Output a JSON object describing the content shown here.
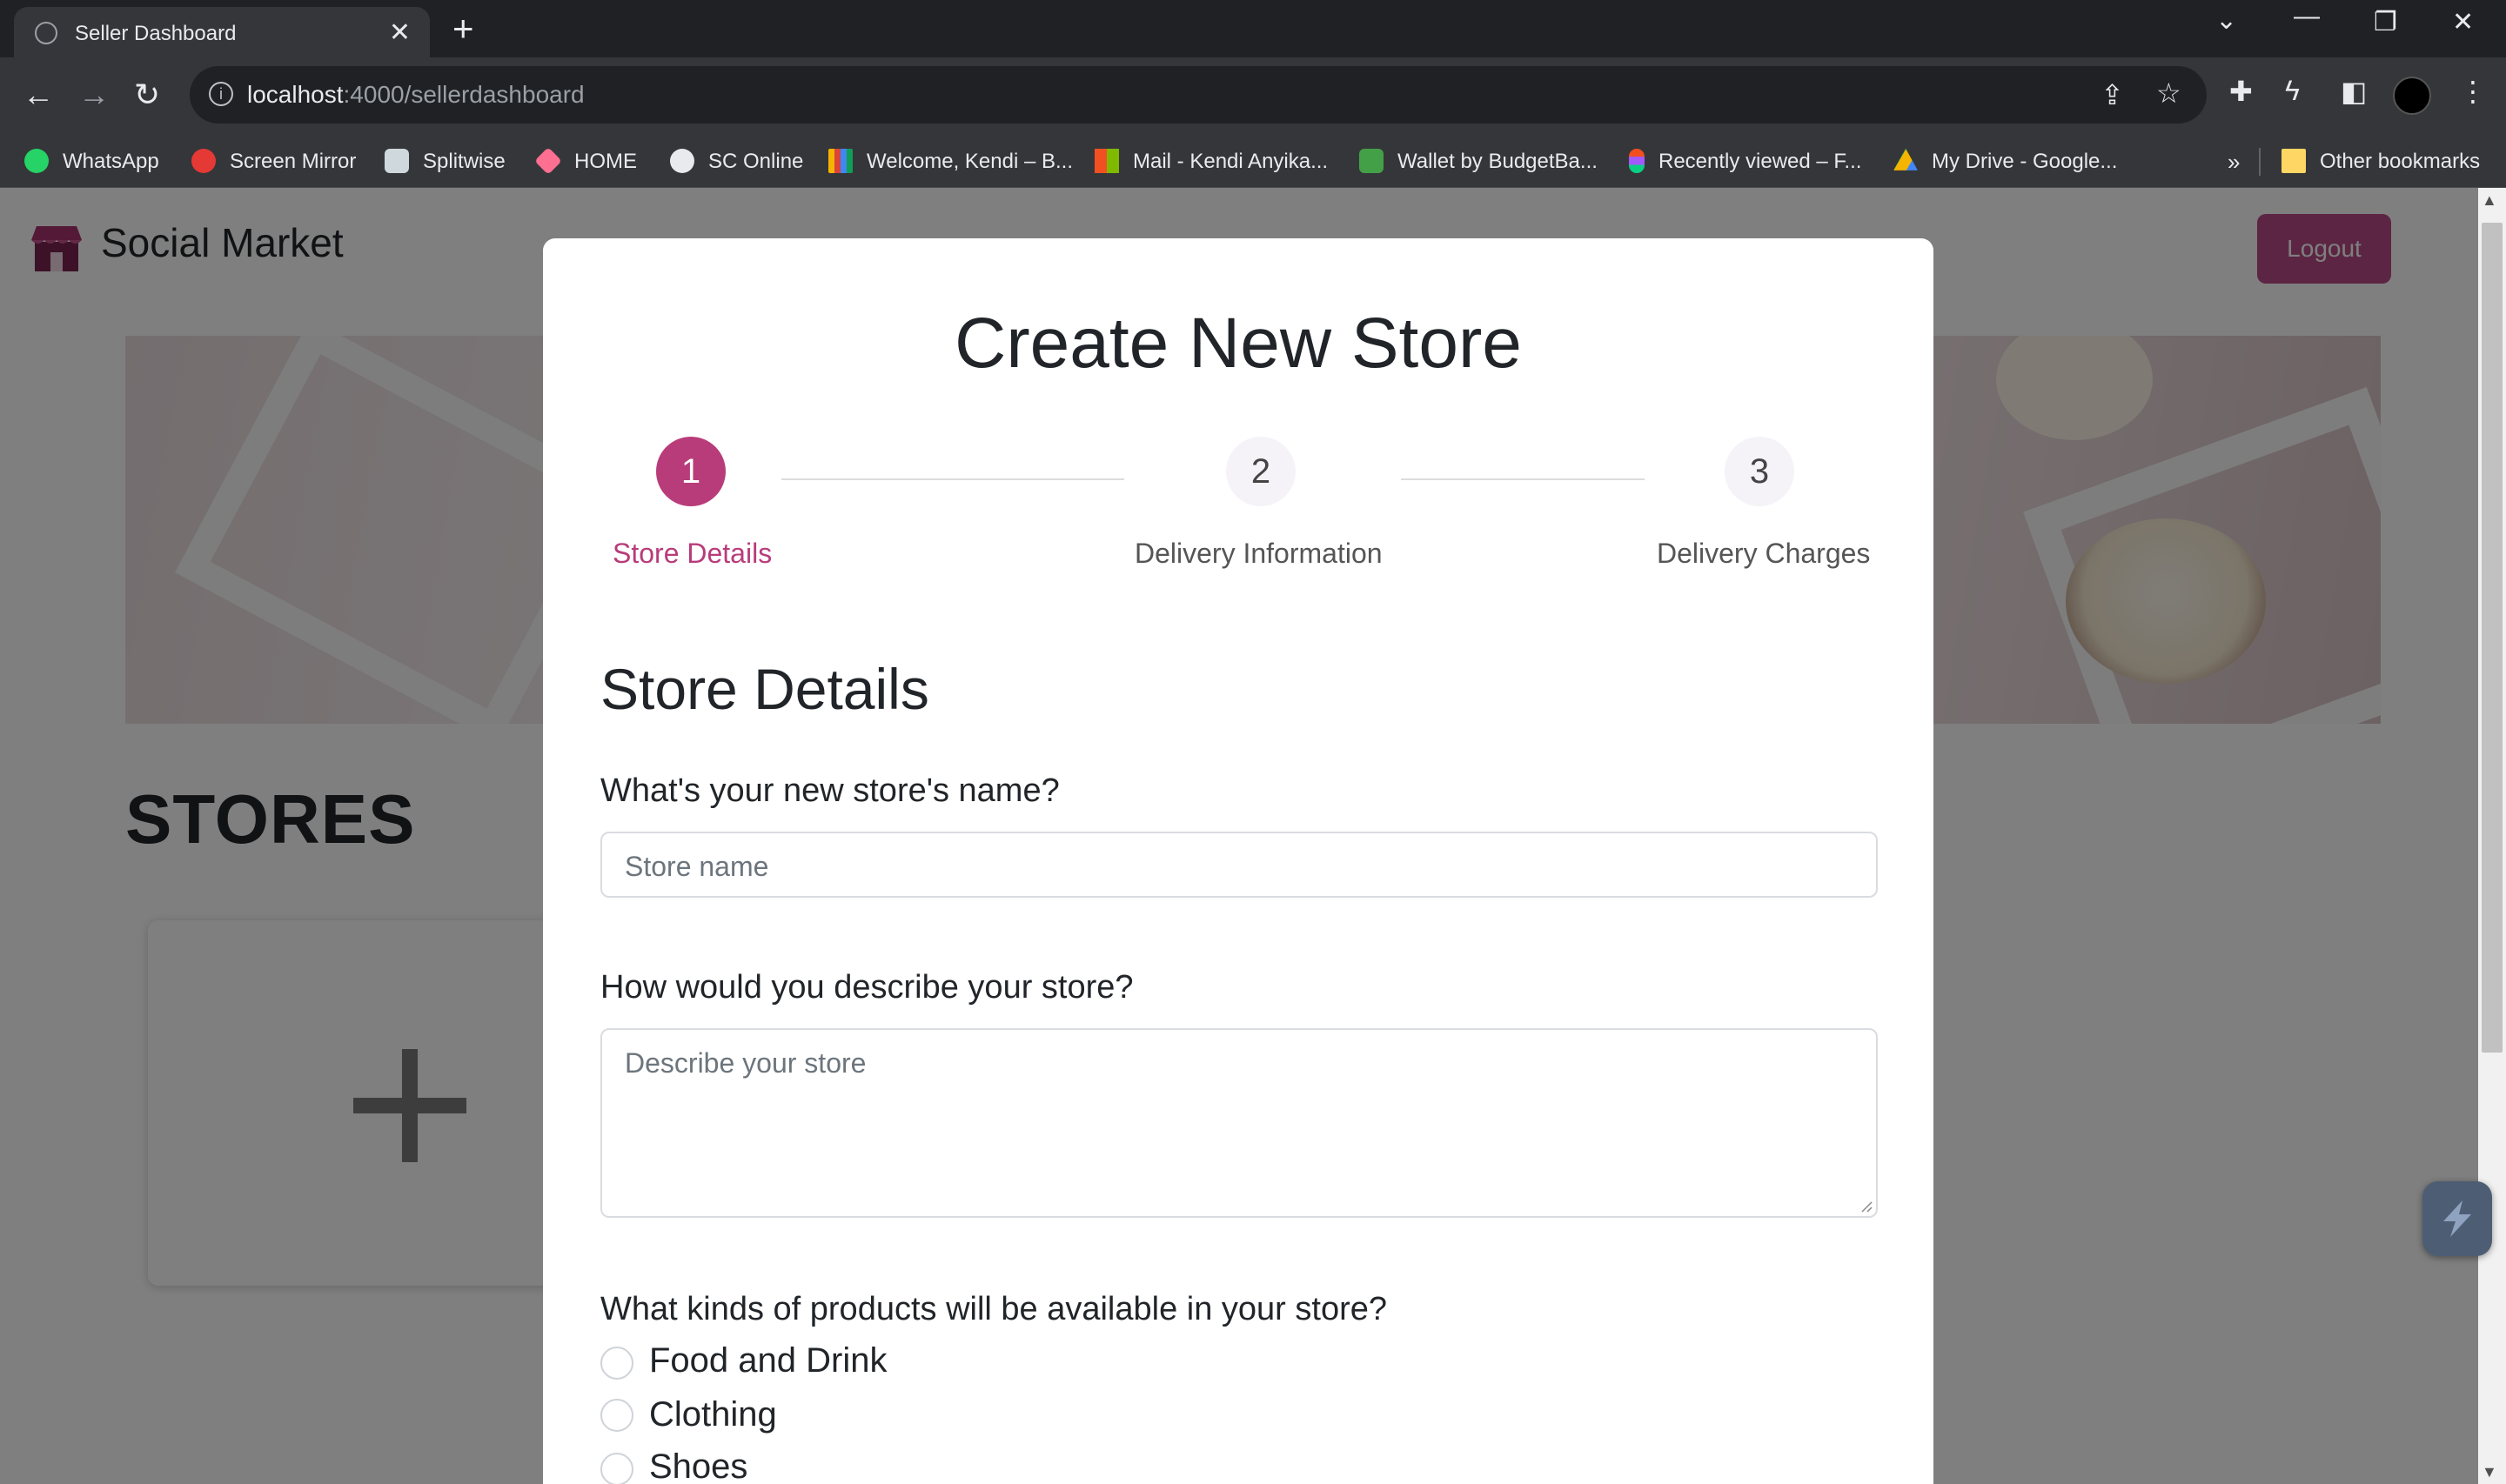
{
  "browser": {
    "tab_title": "Seller Dashboard",
    "url_host": "localhost",
    "url_path": ":4000/sellerdashboard",
    "bookmarks": [
      {
        "label": "WhatsApp",
        "color": "#25d366"
      },
      {
        "label": "Screen Mirror",
        "color": "#e53935"
      },
      {
        "label": "Splitwise",
        "color": "#cfd8dc"
      },
      {
        "label": "HOME",
        "color": "#ff6f91"
      },
      {
        "label": "SC Online",
        "color": "#e8eaed"
      },
      {
        "label": "Welcome, Kendi – B...",
        "color": "#f4b400"
      },
      {
        "label": "Mail - Kendi Anyika...",
        "color": "#f25022"
      },
      {
        "label": "Wallet by BudgetBa...",
        "color": "#43a047"
      },
      {
        "label": "Recently viewed – F...",
        "color": "#a259ff"
      },
      {
        "label": "My Drive - Google...",
        "color": "#0f9d58"
      }
    ],
    "other_bookmarks": "Other bookmarks",
    "overflow": "»"
  },
  "page": {
    "brand": "Social Market",
    "logout_label": "Logout",
    "stores_title": "STORES",
    "add_symbol": "+",
    "accent_color": "#b83c7a"
  },
  "modal": {
    "title": "Create New Store",
    "steps": [
      {
        "number": "1",
        "label": "Store Details",
        "active": true
      },
      {
        "number": "2",
        "label": "Delivery Information",
        "active": false
      },
      {
        "number": "3",
        "label": "Delivery Charges",
        "active": false
      }
    ],
    "section_title": "Store Details",
    "name_question": "What's your new store's name?",
    "name_placeholder": "Store name",
    "describe_question": "How would you describe your store?",
    "describe_placeholder": "Describe your store",
    "products_question": "What kinds of products will be available in your store?",
    "product_options": [
      "Food and Drink",
      "Clothing",
      "Shoes"
    ]
  }
}
